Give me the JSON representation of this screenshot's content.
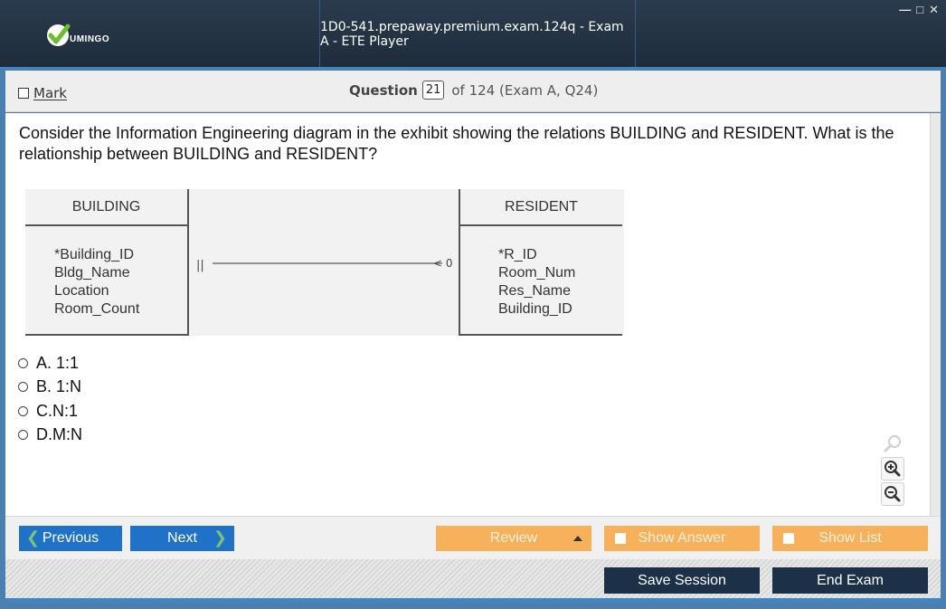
{
  "window": {
    "title": "1D0-541.prepaway.premium.exam.124q - Exam A - ETE Player",
    "logo_text": "UMINGO",
    "controls": [
      "minimize-icon",
      "maximize-icon",
      "close-icon"
    ]
  },
  "header": {
    "mark_label": "Mark",
    "question_label": "Question",
    "question_number": "21",
    "question_of": "of 124 (Exam A, Q24)"
  },
  "question": {
    "text": "Consider the Information Engineering diagram in the exhibit showing the relations BUILDING and RESIDENT. What is the relationship between BUILDING and RESIDENT?"
  },
  "diagram": {
    "left_entity": {
      "name": "BUILDING",
      "attributes": [
        "*Building_ID",
        "Bldg_Name",
        "Location",
        "Room_Count"
      ]
    },
    "right_entity": {
      "name": "RESIDENT",
      "attributes": [
        "*R_ID",
        "Room_Num",
        "Res_Name",
        "Building_ID"
      ]
    },
    "left_symbol": "||",
    "right_symbol": "< 0"
  },
  "options": [
    {
      "letter": "A.",
      "text": "1:1"
    },
    {
      "letter": "B.",
      "text": "1:N"
    },
    {
      "letter": "C.",
      "text": "N:1"
    },
    {
      "letter": "D.",
      "text": "M:N"
    }
  ],
  "zoom": {
    "icons": [
      "zoom-reset-icon",
      "zoom-in-icon",
      "zoom-out-icon"
    ]
  },
  "nav": {
    "previous_label": "Previous",
    "next_label": "Next",
    "review_label": "Review",
    "show_answer_label": "Show Answer",
    "show_list_label": "Show List"
  },
  "footer": {
    "save_label": "Save Session",
    "end_label": "End Exam"
  },
  "colors": {
    "titlebar": "#1e2c3b",
    "accent_blue": "#1f72c7",
    "orange": "#f7b15a",
    "dark_button": "#1c3148",
    "logo_green": "#6cbf2a"
  }
}
